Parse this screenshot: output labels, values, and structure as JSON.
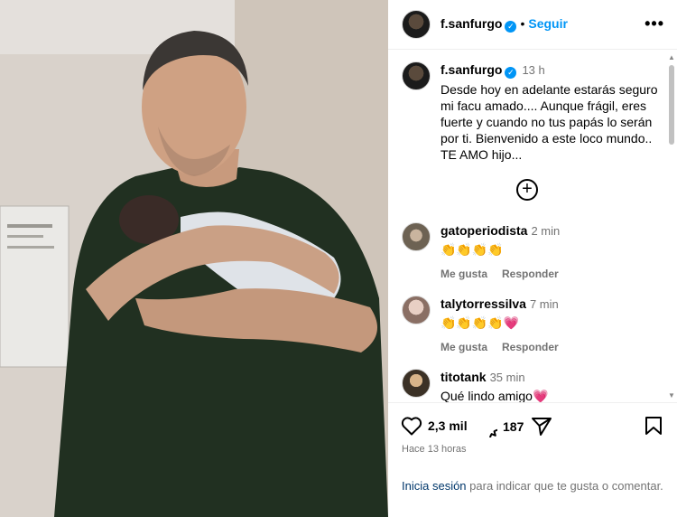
{
  "post": {
    "username": "f.sanfurgo",
    "follow_label": "Seguir",
    "dot": "•"
  },
  "caption": {
    "username": "f.sanfurgo",
    "time": "13 h",
    "text": "Desde hoy en adelante estarás seguro mi facu amado.... Aunque frágil, eres fuerte y cuando no tus papás lo serán por ti. Bienvenido a este loco mundo.. TE AMO hijo..."
  },
  "comments": [
    {
      "user": "gatoperiodista",
      "time": "2 min",
      "text": "👏👏👏👏",
      "like": "Me gusta",
      "reply": "Responder"
    },
    {
      "user": "talytorressilva",
      "time": "7 min",
      "text": "👏👏👏👏💗",
      "like": "Me gusta",
      "reply": "Responder"
    },
    {
      "user": "titotank",
      "time": "35 min",
      "text": "Qué lindo amigo💗"
    }
  ],
  "stats": {
    "likes": "2,3 mil",
    "comments": "187"
  },
  "timestamp": "Hace 13 horas",
  "login": {
    "link": "Inicia sesión",
    "rest": " para indicar que te gusta o comentar."
  },
  "colors": {
    "accent": "#0095f6",
    "muted": "#737373",
    "link": "#00376b"
  }
}
